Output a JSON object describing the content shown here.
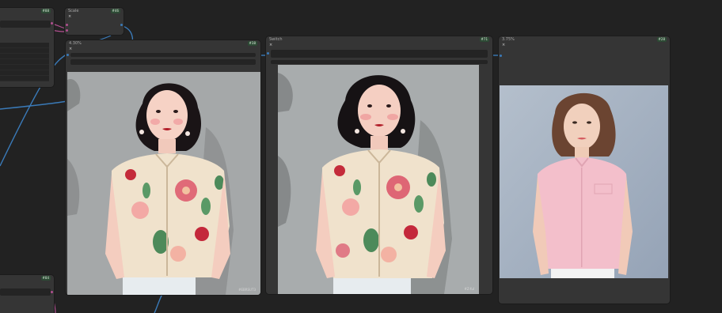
{
  "canvas": {
    "background": "#222222",
    "node_background": "#353535",
    "input_background": "#242424",
    "badge_background": "#2d4a35",
    "wire_color": "#3a7ab8",
    "link_color": "#b04f8f"
  },
  "nodes": {
    "top_left": {
      "badge": "#88"
    },
    "small_top": {
      "title": "Scale",
      "badge": "#46"
    },
    "preview_1": {
      "title": "4.30%",
      "badge": "#38",
      "close_glyph": "×"
    },
    "preview_2": {
      "title": "Switch",
      "badge": "#71",
      "close_glyph": "×"
    },
    "preview_3": {
      "title": "3.75%",
      "badge": "#28",
      "close_glyph": "×"
    },
    "bottom_left": {
      "badge": "#84"
    }
  },
  "images": {
    "illustration_1": {
      "description_icon": "illustrated-woman-floral-blouse",
      "signature": "#EBRSUT3"
    },
    "illustration_2": {
      "description_icon": "illustrated-woman-floral-blouse",
      "signature": "#Z-ful"
    },
    "photo": {
      "description_icon": "photo-woman-pink-blouse"
    }
  }
}
